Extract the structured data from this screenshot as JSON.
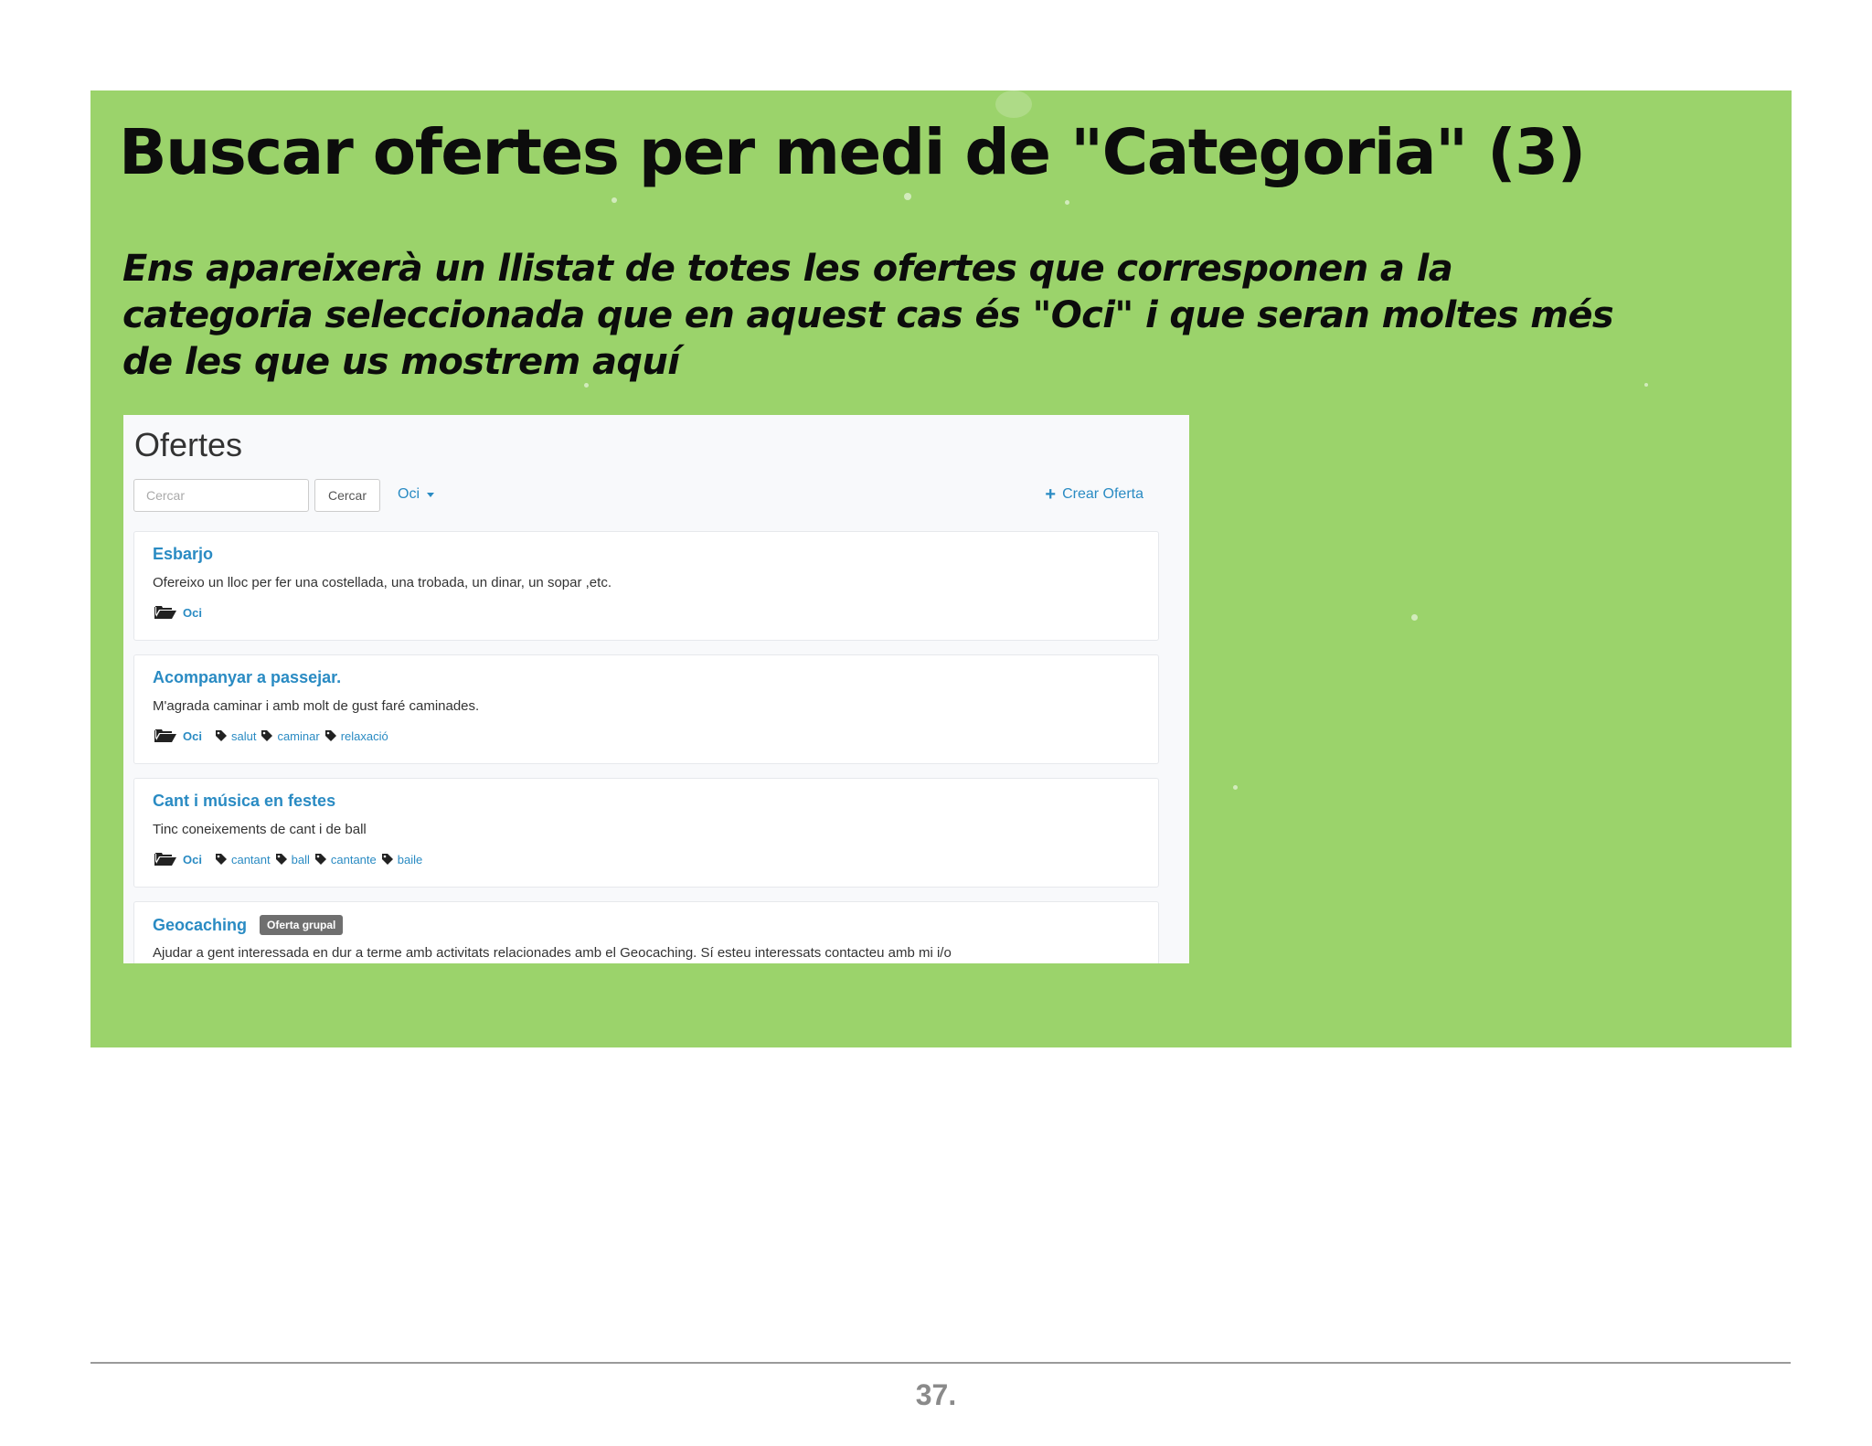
{
  "slide": {
    "title": "Buscar ofertes per medi de \"Categoria\" (3)",
    "subtitle": "Ens apareixerà un llistat de totes les ofertes que corresponen a la categoria seleccionada que en aquest cas és \"Oci\" i que seran moltes més de les que us mostrem aquí",
    "background_color": "#9bd36b"
  },
  "screenshot": {
    "page_title": "Ofertes",
    "search": {
      "placeholder": "Cercar",
      "value": ""
    },
    "search_button_label": "Cercar",
    "category_dropdown": {
      "selected": "Oci"
    },
    "create_offer_label": "Crear Oferta",
    "accent_color": "#2a8bc3",
    "offers": [
      {
        "title": "Esbarjo",
        "badge": "",
        "description": "Ofereixo un lloc per fer una costellada, una trobada, un dinar, un sopar ,etc.",
        "category": "Oci",
        "tags": []
      },
      {
        "title": "Acompanyar a passejar.",
        "badge": "",
        "description": "M'agrada caminar i amb molt de gust faré caminades.",
        "category": "Oci",
        "tags": [
          "salut",
          "caminar",
          "relaxació"
        ]
      },
      {
        "title": "Cant i música en festes",
        "badge": "",
        "description": "Tinc coneixements de cant i de ball",
        "category": "Oci",
        "tags": [
          "cantant",
          "ball",
          "cantante",
          "baile"
        ]
      },
      {
        "title": "Geocaching",
        "badge": "Oferta grupal",
        "description": "Ajudar a gent interessada en dur a terme amb activitats relacionades amb el Geocaching. Sí esteu interessats contacteu amb mi i/o",
        "category": "",
        "tags": []
      }
    ]
  },
  "footer": {
    "page_number": "37."
  }
}
